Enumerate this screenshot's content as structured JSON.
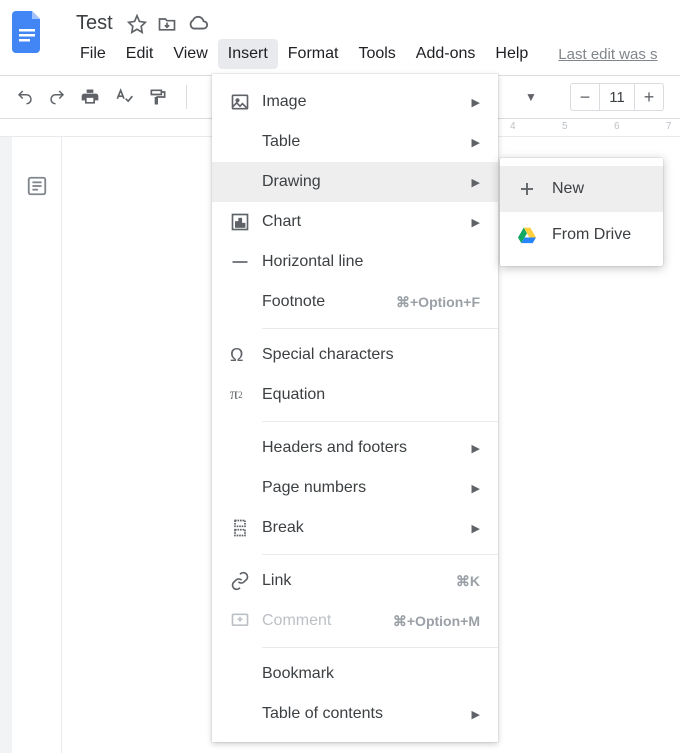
{
  "header": {
    "title": "Test",
    "title_icons": [
      "star-icon",
      "move-icon",
      "cloud-icon"
    ]
  },
  "menubar": {
    "items": [
      "File",
      "Edit",
      "View",
      "Insert",
      "Format",
      "Tools",
      "Add-ons",
      "Help"
    ],
    "active_index": 3,
    "last_edit": "Last edit was s"
  },
  "toolbar": {
    "font_size": "11"
  },
  "ruler": {
    "marks": [
      "4",
      "5",
      "6",
      "7"
    ]
  },
  "insert_menu": {
    "items": [
      {
        "icon": "image-icon",
        "label": "Image",
        "has_submenu": true
      },
      {
        "icon": "",
        "label": "Table",
        "has_submenu": true
      },
      {
        "icon": "",
        "label": "Drawing",
        "has_submenu": true,
        "hover": true
      },
      {
        "icon": "chart-icon",
        "label": "Chart",
        "has_submenu": true
      },
      {
        "icon": "line-icon",
        "label": "Horizontal line"
      },
      {
        "icon": "",
        "label": "Footnote",
        "shortcut": "⌘+Option+F"
      },
      {
        "sep": true
      },
      {
        "icon": "omega-icon",
        "label": "Special characters"
      },
      {
        "icon": "pi-icon",
        "label": "Equation"
      },
      {
        "sep": true
      },
      {
        "icon": "",
        "label": "Headers and footers",
        "has_submenu": true
      },
      {
        "icon": "",
        "label": "Page numbers",
        "has_submenu": true
      },
      {
        "icon": "break-icon",
        "label": "Break",
        "has_submenu": true
      },
      {
        "sep": true
      },
      {
        "icon": "link-icon",
        "label": "Link",
        "shortcut": "⌘K"
      },
      {
        "icon": "comment-icon",
        "label": "Comment",
        "shortcut": "⌘+Option+M",
        "disabled": true
      },
      {
        "sep": true
      },
      {
        "icon": "",
        "label": "Bookmark"
      },
      {
        "icon": "",
        "label": "Table of contents",
        "has_submenu": true
      }
    ]
  },
  "drawing_submenu": {
    "items": [
      {
        "icon": "plus-icon",
        "label": "New",
        "hover": true
      },
      {
        "icon": "drive-icon",
        "label": "From Drive"
      }
    ]
  }
}
